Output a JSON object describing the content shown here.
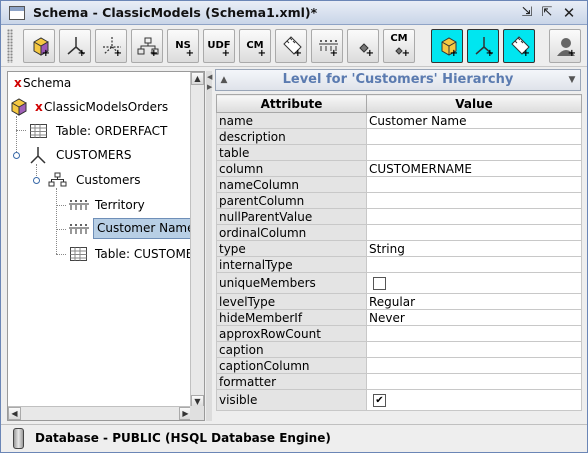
{
  "window": {
    "title": "Schema - ClassicModels (Schema1.xml)*"
  },
  "toolbar": {
    "buttons": [
      {
        "name": "add-cube",
        "label": ""
      },
      {
        "name": "add-dimension",
        "label": ""
      },
      {
        "name": "add-dimension-usage",
        "label": ""
      },
      {
        "name": "add-hierarchy",
        "label": ""
      },
      {
        "name": "add-named-set",
        "label": "NS"
      },
      {
        "name": "add-user-defined-function",
        "label": "UDF"
      },
      {
        "name": "add-calculated-member",
        "label": "CM"
      },
      {
        "name": "add-measure",
        "label": ""
      },
      {
        "name": "add-level",
        "label": ""
      },
      {
        "name": "add-property",
        "label": ""
      },
      {
        "name": "add-calculated-member-property",
        "label": "CM"
      },
      {
        "name": "add-virtual-cube",
        "label": ""
      },
      {
        "name": "add-virtual-cube-dimension",
        "label": ""
      },
      {
        "name": "add-virtual-cube-measure",
        "label": ""
      },
      {
        "name": "add-role",
        "label": ""
      }
    ]
  },
  "tree": {
    "schema": {
      "marker": "x",
      "label": "Schema"
    },
    "cube": {
      "marker": "x",
      "label": "ClassicModelsOrders"
    },
    "fact_table": "Table: ORDERFACT",
    "dimension": "CUSTOMERS",
    "hierarchy": "Customers",
    "levels": [
      "Territory",
      "Customer Name"
    ],
    "dim_table": "Table: CUSTOMER_"
  },
  "panel": {
    "title": "Level for 'Customers' Hierarchy",
    "columns": [
      "Attribute",
      "Value"
    ],
    "rows": [
      {
        "attr": "name",
        "value": "Customer Name"
      },
      {
        "attr": "description",
        "value": ""
      },
      {
        "attr": "table",
        "value": ""
      },
      {
        "attr": "column",
        "value": "CUSTOMERNAME"
      },
      {
        "attr": "nameColumn",
        "value": ""
      },
      {
        "attr": "parentColumn",
        "value": ""
      },
      {
        "attr": "nullParentValue",
        "value": ""
      },
      {
        "attr": "ordinalColumn",
        "value": ""
      },
      {
        "attr": "type",
        "value": "String"
      },
      {
        "attr": "internalType",
        "value": ""
      },
      {
        "attr": "uniqueMembers",
        "checkbox": false
      },
      {
        "attr": "levelType",
        "value": "Regular"
      },
      {
        "attr": "hideMemberIf",
        "value": "Never"
      },
      {
        "attr": "approxRowCount",
        "value": ""
      },
      {
        "attr": "caption",
        "value": ""
      },
      {
        "attr": "captionColumn",
        "value": ""
      },
      {
        "attr": "formatter",
        "value": ""
      },
      {
        "attr": "visible",
        "checkbox": true
      }
    ]
  },
  "status": {
    "text": "Database - PUBLIC (HSQL Database Engine)"
  }
}
